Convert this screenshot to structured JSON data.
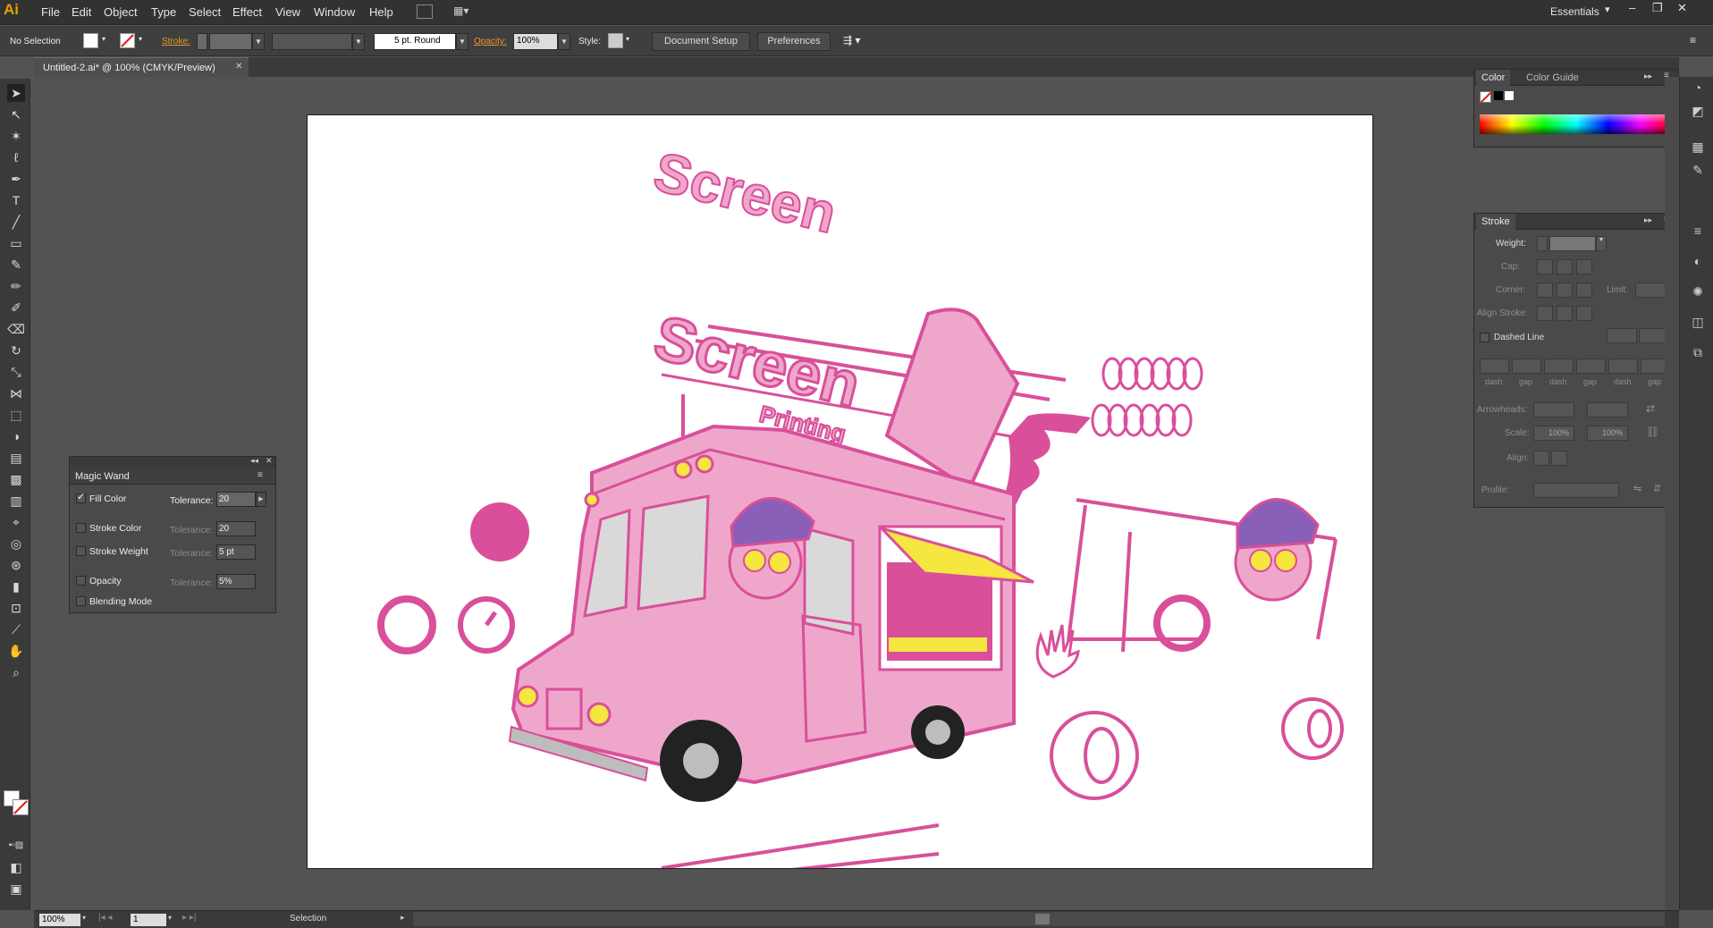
{
  "app": {
    "logo": "Ai",
    "workspace": "Essentials"
  },
  "menu": [
    "File",
    "Edit",
    "Object",
    "Type",
    "Select",
    "Effect",
    "View",
    "Window",
    "Help"
  ],
  "control": {
    "selection": "No Selection",
    "stroke_label": "Stroke:",
    "brush": "5 pt. Round",
    "opacity_label": "Opacity:",
    "opacity": "100%",
    "style_label": "Style:",
    "doc_setup": "Document Setup",
    "preferences": "Preferences"
  },
  "document": {
    "tab": "Untitled-2.ai* @ 100% (CMYK/Preview)"
  },
  "magic_wand": {
    "title": "Magic Wand",
    "fill_color": "Fill Color",
    "fill_tol": "20",
    "stroke_color": "Stroke Color",
    "stroke_tol": "20",
    "stroke_weight": "Stroke Weight",
    "weight_tol": "5 pt",
    "opacity": "Opacity",
    "opacity_tol": "5%",
    "blending": "Blending Mode",
    "tolerance": "Tolerance:"
  },
  "color_panel": {
    "tab1": "Color",
    "tab2": "Color Guide"
  },
  "stroke_panel": {
    "title": "Stroke",
    "weight": "Weight:",
    "cap": "Cap:",
    "corner": "Corner:",
    "limit": "Limit:",
    "align": "Align Stroke:",
    "dashed": "Dashed Line",
    "dash": "dash",
    "gap": "gap",
    "arrowheads": "Arrowheads:",
    "scale": "Scale:",
    "scale1": "100%",
    "scale2": "100%",
    "align2": "Align:",
    "profile": "Profile:"
  },
  "artwork": {
    "title1": "Screen",
    "title2": "Screen",
    "sub": "Printing",
    "accent": "#d94f9a",
    "pink": "#eea7cb",
    "yellow": "#f5e640"
  },
  "status": {
    "zoom": "100%",
    "page": "1",
    "tool": "Selection"
  }
}
